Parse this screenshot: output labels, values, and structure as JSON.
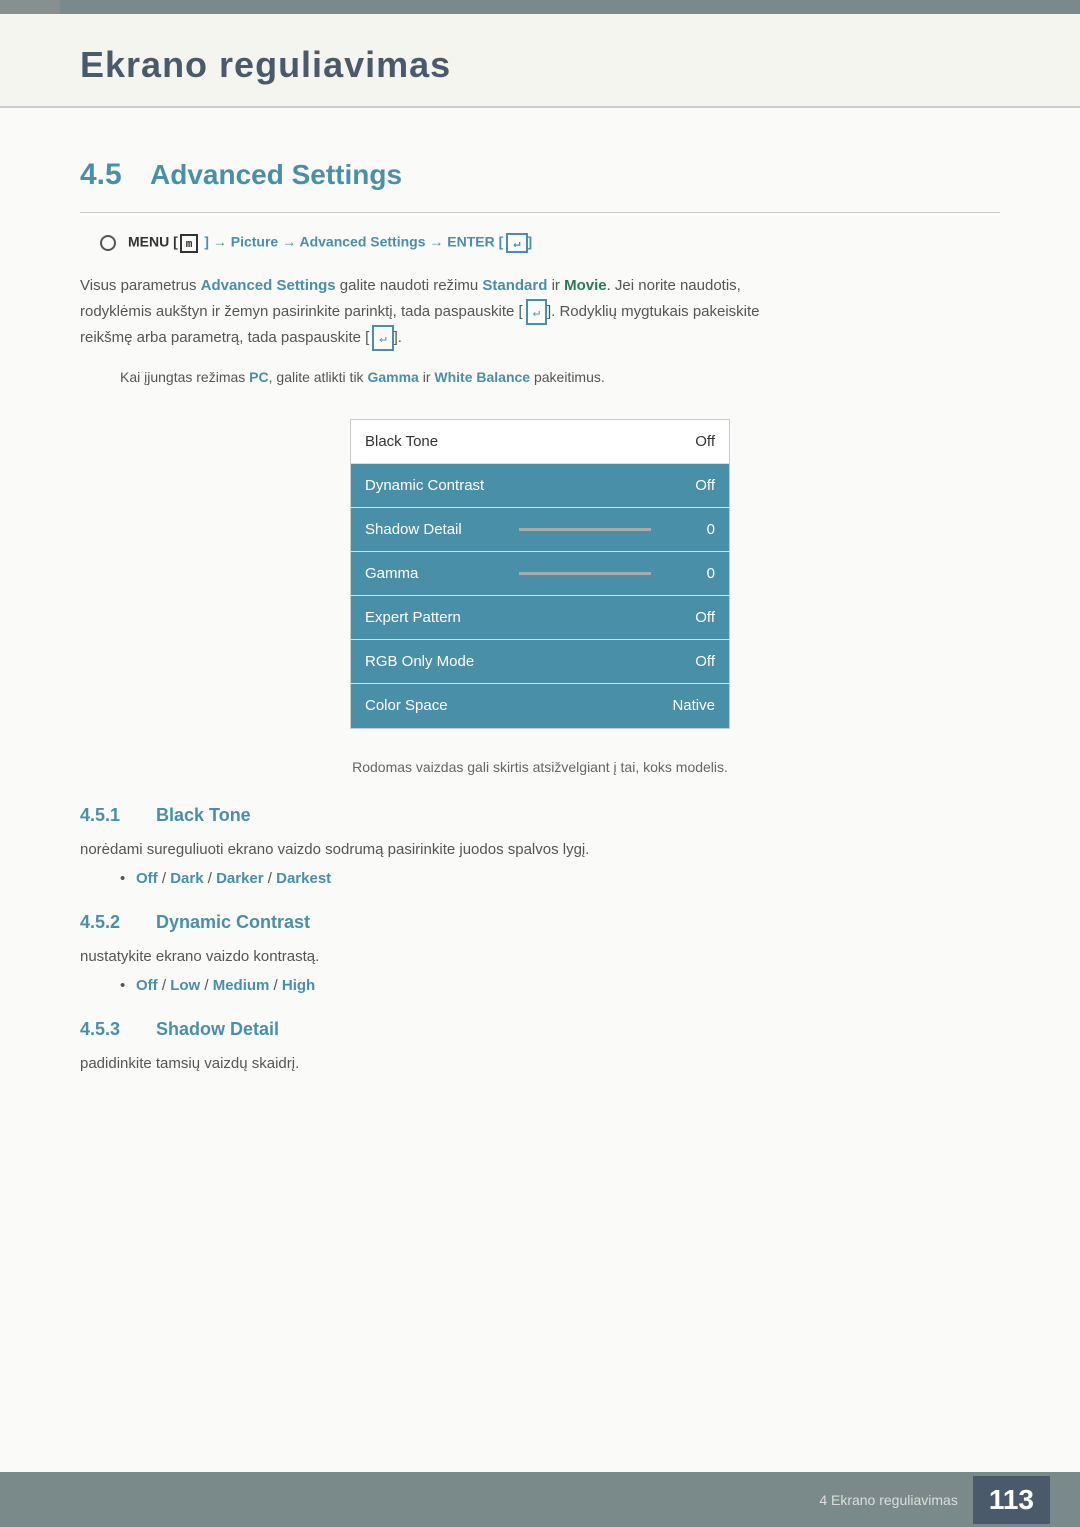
{
  "page": {
    "title": "Ekrano reguliavimas",
    "footer_label": "4 Ekrano reguliavimas",
    "footer_page": "113"
  },
  "section": {
    "number": "4.5",
    "title": "Advanced Settings"
  },
  "nav": {
    "path_prefix": "MENU [",
    "menu_icon": "m",
    "path_middle": "] → Picture → Advanced Settings → ENTER [",
    "enter_icon": "↵",
    "path_end": "]"
  },
  "description": {
    "line1": "Visus parametrus Advanced Settings galite naudoti režimu Standard ir Movie. Jei norite naudotis,",
    "line2": "rodyklėmis aukštyn ir žemyn pasirinkite parinktį, tada paspauskite [",
    "line2b": "]. Rodyklių mygtukais pakeiskite",
    "line3": "reikšmę arba parametrą, tada paspauskite [",
    "line3b": "]."
  },
  "note": {
    "text": "Kai įjungtas režimas PC, galite atlikti tik Gamma ir White Balance pakeitimus."
  },
  "menu_table": {
    "rows": [
      {
        "label": "Black Tone",
        "value": "Off",
        "highlighted": false,
        "has_slider": false
      },
      {
        "label": "Dynamic Contrast",
        "value": "Off",
        "highlighted": true,
        "has_slider": false
      },
      {
        "label": "Shadow Detail",
        "value": "0",
        "highlighted": true,
        "has_slider": true
      },
      {
        "label": "Gamma",
        "value": "0",
        "highlighted": true,
        "has_slider": true
      },
      {
        "label": "Expert Pattern",
        "value": "Off",
        "highlighted": true,
        "has_slider": false
      },
      {
        "label": "RGB Only Mode",
        "value": "Off",
        "highlighted": true,
        "has_slider": false
      },
      {
        "label": "Color Space",
        "value": "Native",
        "highlighted": true,
        "has_slider": false
      }
    ]
  },
  "footnote": {
    "text": "Rodomas vaizdas gali skirtis atsižvelgiant į tai, koks modelis."
  },
  "subsections": [
    {
      "number": "4.5.1",
      "title": "Black Tone",
      "desc": "norėdami sureguliuoti ekrano vaizdo sodrumą pasirinkite juodos spalvos lygį.",
      "options": [
        {
          "text": "Off",
          "cyan": true
        },
        {
          "text": " / ",
          "cyan": false
        },
        {
          "text": "Dark",
          "cyan": true
        },
        {
          "text": " / ",
          "cyan": false
        },
        {
          "text": "Darker",
          "cyan": true
        },
        {
          "text": " / ",
          "cyan": false
        },
        {
          "text": "Darkest",
          "cyan": true
        }
      ]
    },
    {
      "number": "4.5.2",
      "title": "Dynamic Contrast",
      "desc": "nustatykite ekrano vaizdo kontrastą.",
      "options": [
        {
          "text": "Off",
          "cyan": true
        },
        {
          "text": " / ",
          "cyan": false
        },
        {
          "text": "Low",
          "cyan": true
        },
        {
          "text": " / ",
          "cyan": false
        },
        {
          "text": "Medium",
          "cyan": true
        },
        {
          "text": " / ",
          "cyan": false
        },
        {
          "text": "High",
          "cyan": true
        }
      ]
    },
    {
      "number": "4.5.3",
      "title": "Shadow Detail",
      "desc": "padidinkite tamsių vaizdų skaidrį.",
      "options": []
    }
  ]
}
